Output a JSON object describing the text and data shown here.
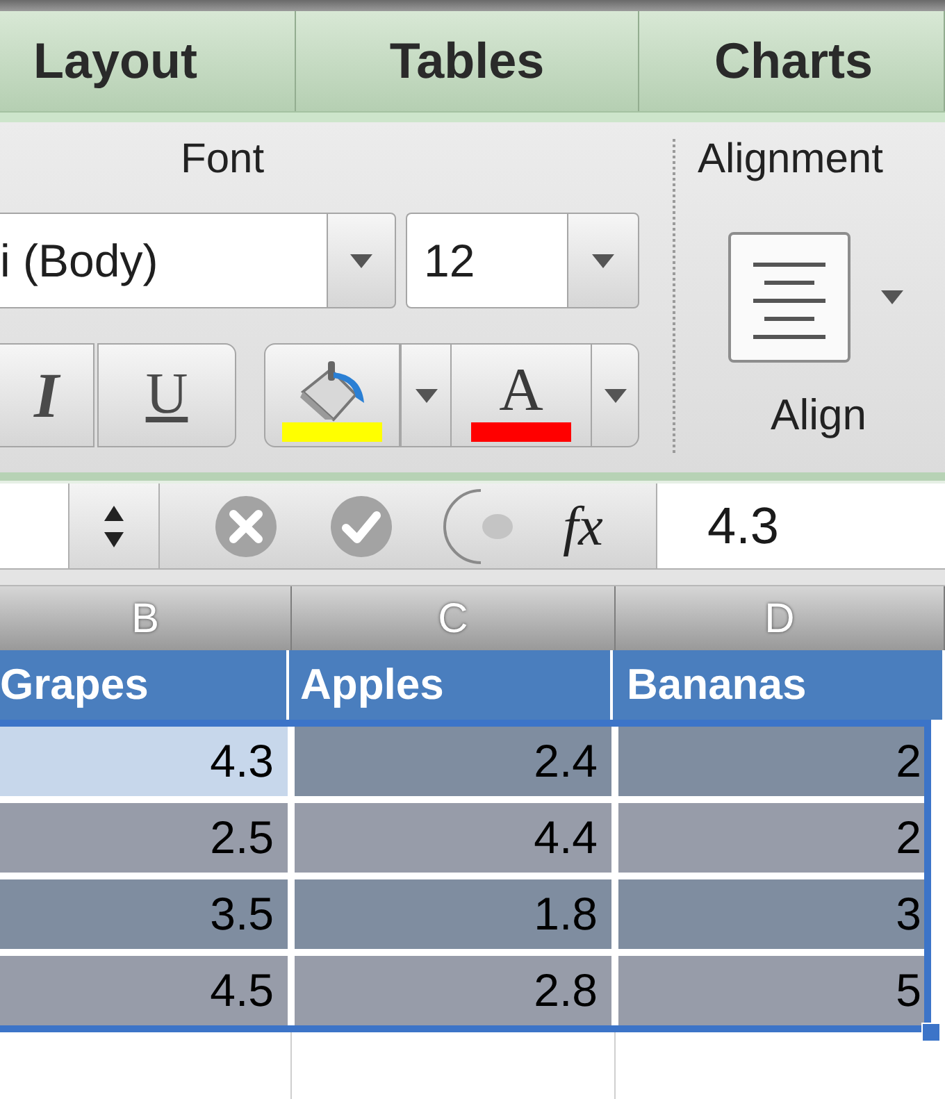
{
  "tabs": [
    {
      "label": "Layout",
      "selected": false
    },
    {
      "label": "Tables",
      "selected": false
    },
    {
      "label": "Charts",
      "selected": false
    }
  ],
  "ribbon": {
    "font_group": {
      "title": "Font",
      "font_name": {
        "value": "i (Body)"
      },
      "font_size": {
        "value": "12"
      },
      "style_buttons": [
        {
          "kind": "italic",
          "label": "I"
        },
        {
          "kind": "underline",
          "label": "U"
        }
      ],
      "color_buttons": [
        {
          "kind": "fill",
          "color": "#ffff00"
        },
        {
          "kind": "text",
          "label": "A",
          "color": "#ff0000"
        }
      ]
    },
    "alignment_group": {
      "title": "Alignment",
      "align_button": {
        "label": "Align"
      }
    }
  },
  "formula_bar": {
    "function_label": "fx",
    "value": "4.3"
  },
  "sheet": {
    "columns": [
      "B",
      "C",
      "D"
    ],
    "header": [
      "Grapes",
      "Apples",
      "Bananas"
    ],
    "rows": [
      {
        "selected": true,
        "cells": [
          {
            "value": "4.3",
            "active": true
          },
          {
            "value": "2.4",
            "active": false
          },
          {
            "value": "2",
            "active": false
          }
        ]
      },
      {
        "selected": true,
        "cells": [
          {
            "value": "2.5",
            "active": false
          },
          {
            "value": "4.4",
            "active": false
          },
          {
            "value": "2",
            "active": false
          }
        ]
      },
      {
        "selected": true,
        "cells": [
          {
            "value": "3.5",
            "active": false
          },
          {
            "value": "1.8",
            "active": false
          },
          {
            "value": "3",
            "active": false
          }
        ]
      },
      {
        "selected": true,
        "cells": [
          {
            "value": "4.5",
            "active": false
          },
          {
            "value": "2.8",
            "active": false
          },
          {
            "value": "5",
            "active": false
          }
        ]
      }
    ]
  }
}
